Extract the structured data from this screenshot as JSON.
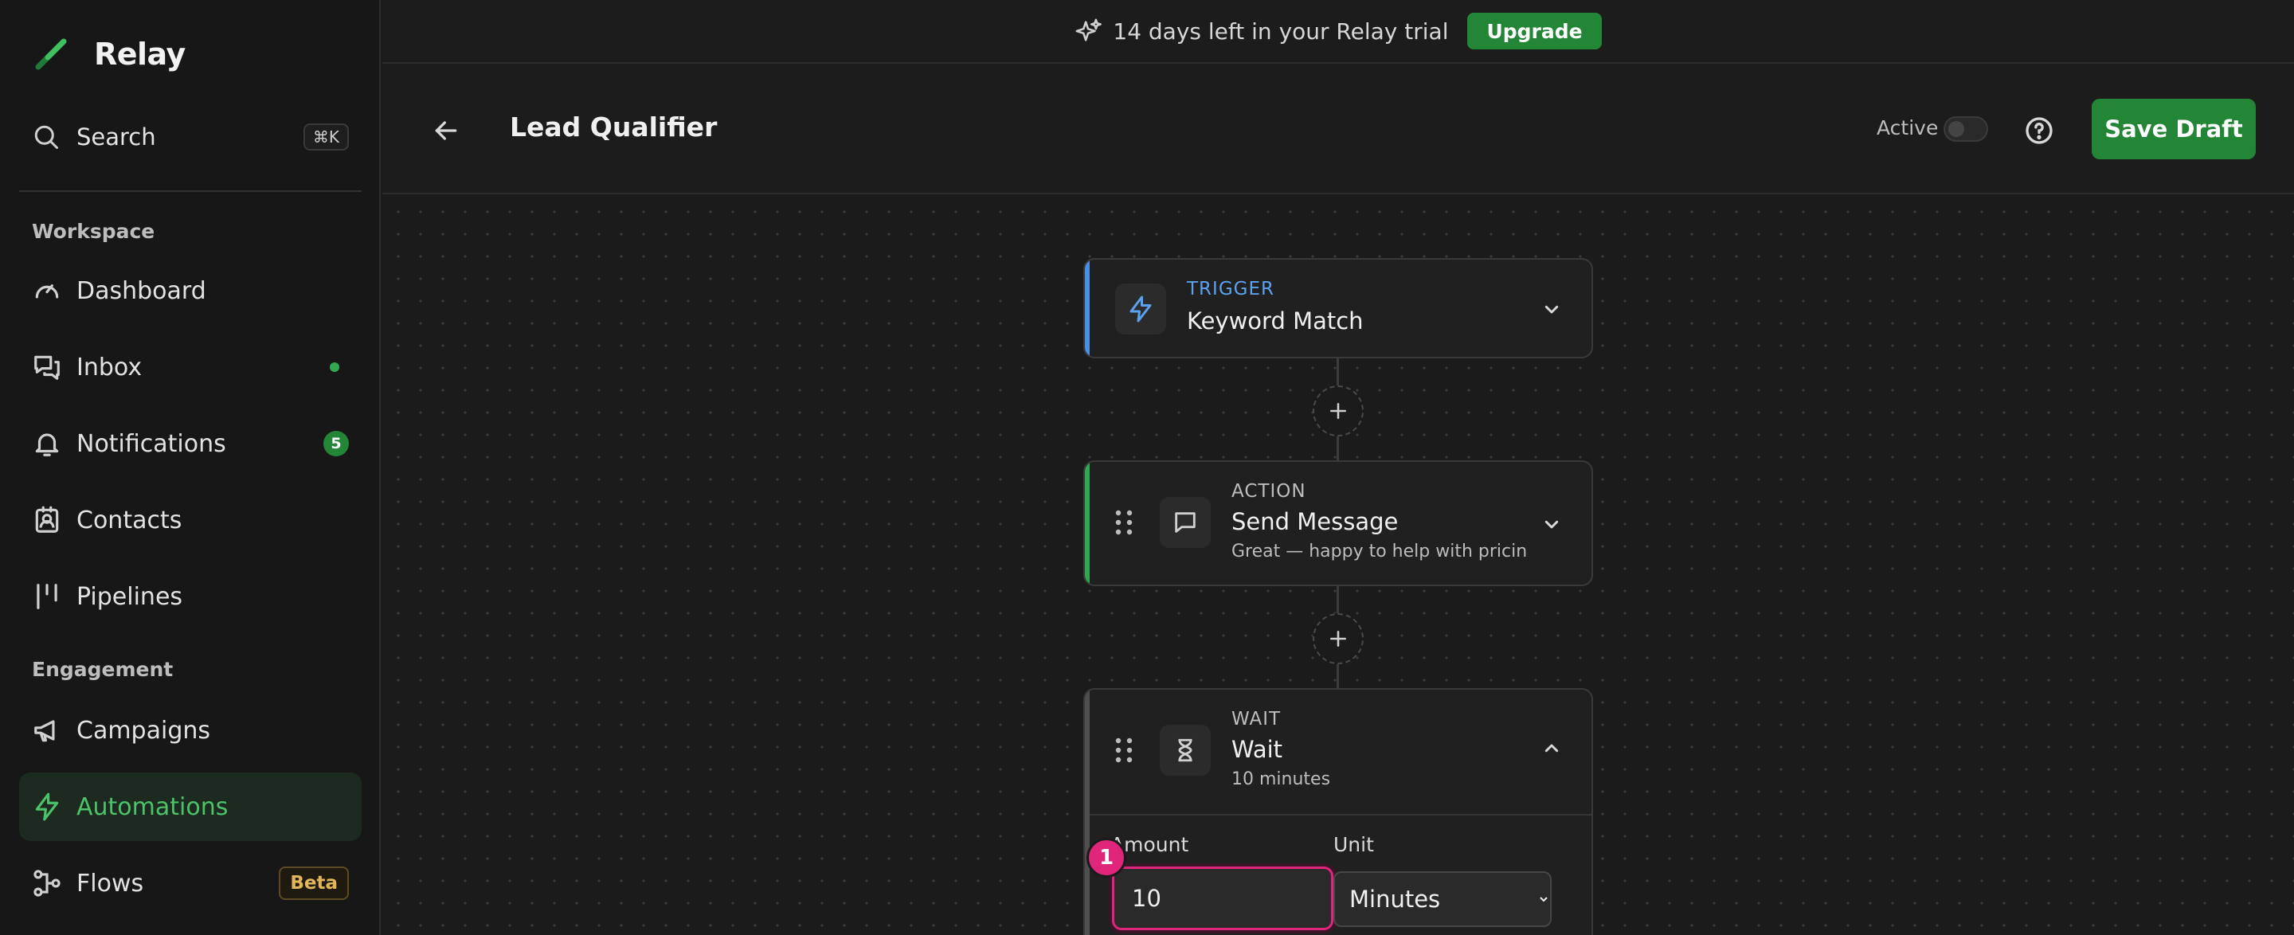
{
  "brand": {
    "name": "Relay",
    "accent": "#2fa84f"
  },
  "search": {
    "label": "Search",
    "shortcut": "⌘K",
    "icon": "search-icon"
  },
  "sidebar": {
    "sections": [
      {
        "label": "Workspace"
      },
      {
        "label": "Engagement"
      }
    ],
    "items": [
      {
        "label": "Dashboard",
        "icon": "gauge-icon"
      },
      {
        "label": "Inbox",
        "icon": "inbox-icon",
        "unread_dot": true
      },
      {
        "label": "Notifications",
        "icon": "bell-icon",
        "badge": "5"
      },
      {
        "label": "Contacts",
        "icon": "contact-card-icon"
      },
      {
        "label": "Pipelines",
        "icon": "pipeline-icon"
      },
      {
        "label": "Campaigns",
        "icon": "megaphone-icon"
      },
      {
        "label": "Automations",
        "icon": "lightning-icon",
        "active": true
      },
      {
        "label": "Flows",
        "icon": "flow-icon",
        "badge": "Beta"
      }
    ]
  },
  "banner": {
    "text": "14 days left in your Relay trial",
    "button": "Upgrade",
    "icon": "sparkles-icon"
  },
  "header": {
    "title": "Lead Qualifier",
    "active_label": "Active",
    "active_on": false,
    "save_label": "Save Draft"
  },
  "flow": {
    "nodes": [
      {
        "type": "TRIGGER",
        "title": "Keyword Match",
        "icon": "lightning-icon",
        "accent": "#4a90e2",
        "expanded": false
      },
      {
        "type": "ACTION",
        "title": "Send Message",
        "subtitle": "Great — happy to help with pricing! ...",
        "icon": "message-icon",
        "accent": "#2fa84f",
        "expanded": false
      },
      {
        "type": "WAIT",
        "title": "Wait",
        "subtitle": "10 minutes",
        "icon": "hourglass-icon",
        "accent": "#555555",
        "expanded": true,
        "fields": {
          "amount_label": "Amount",
          "amount_value": "10",
          "unit_label": "Unit",
          "unit_value": "Minutes"
        }
      }
    ],
    "step_marker": "1"
  }
}
